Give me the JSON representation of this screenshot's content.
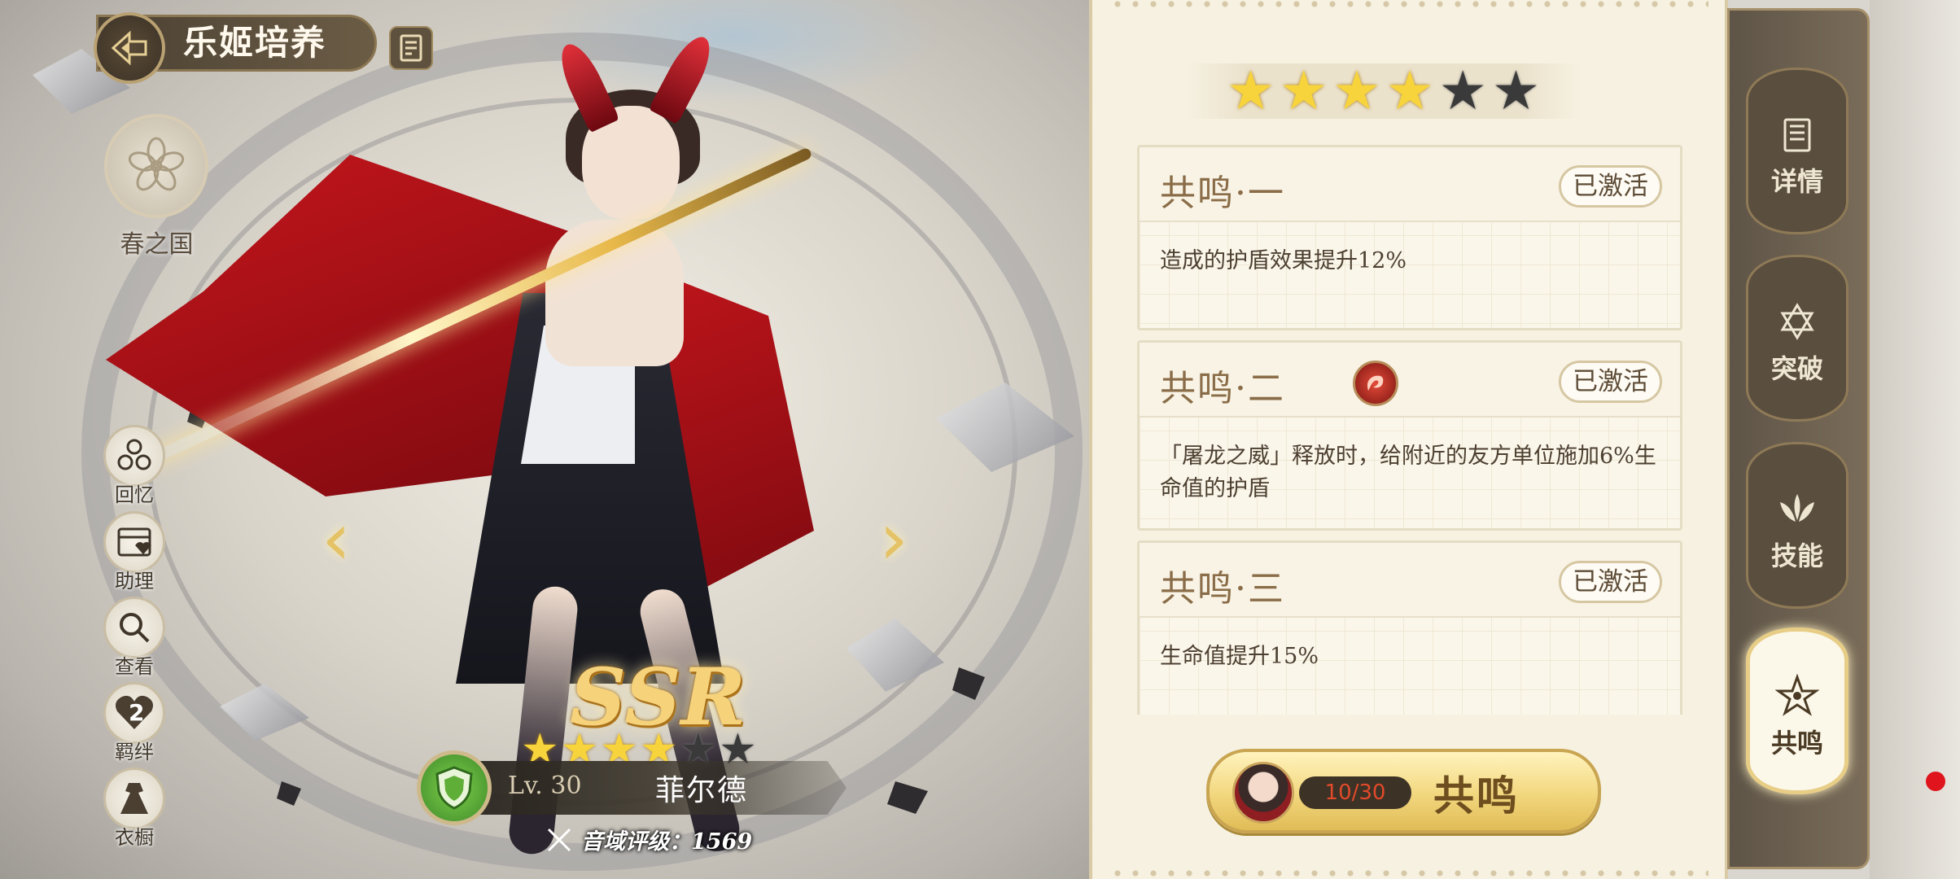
{
  "header": {
    "title": "乐姬培养",
    "back_icon": "back-arrow-icon",
    "doc_icon": "archive-icon"
  },
  "faction": {
    "name": "春之国",
    "icon": "cherry-blossom-icon"
  },
  "side_menu": [
    {
      "label": "回忆",
      "icon": "memory-icon"
    },
    {
      "label": "助理",
      "icon": "assistant-icon"
    },
    {
      "label": "查看",
      "icon": "magnifier-icon"
    },
    {
      "label": "羁绊",
      "icon": "heart-icon",
      "count": "2"
    },
    {
      "label": "衣橱",
      "icon": "dress-icon"
    }
  ],
  "character": {
    "rarity": "SSR",
    "stars_total": 6,
    "stars_filled": 4,
    "level": "Lv. 30",
    "name": "菲尔德",
    "class_icon": "shield-icon",
    "rating": "音域评级：1569"
  },
  "resonance": {
    "stars_total": 6,
    "stars_filled": 4,
    "cards": [
      {
        "title": "共鸣·一",
        "status": "已激活",
        "description": "造成的护盾效果提升12%"
      },
      {
        "title": "共鸣·二",
        "status": "已激活",
        "description": "「屠龙之威」释放时，给附近的友方单位施加6%生命值的护盾",
        "has_skill_icon": true
      },
      {
        "title": "共鸣·三",
        "status": "已激活",
        "description": "生命值提升15%"
      }
    ],
    "button": {
      "count": "10/30",
      "label": "共鸣"
    }
  },
  "right_nav": [
    {
      "label": "详情",
      "icon": "book-icon",
      "active": false
    },
    {
      "label": "突破",
      "icon": "hexagram-icon",
      "active": false
    },
    {
      "label": "技能",
      "icon": "lotus-icon",
      "active": false
    },
    {
      "label": "共鸣",
      "icon": "resonance-star-icon",
      "active": true
    }
  ],
  "colors": {
    "accent_gold": "#e0bc56",
    "star_on": "#f8d43c",
    "star_off": "#3a3a3a",
    "count_red": "#e14a2a",
    "panel_bg": "#f6f1e1"
  }
}
